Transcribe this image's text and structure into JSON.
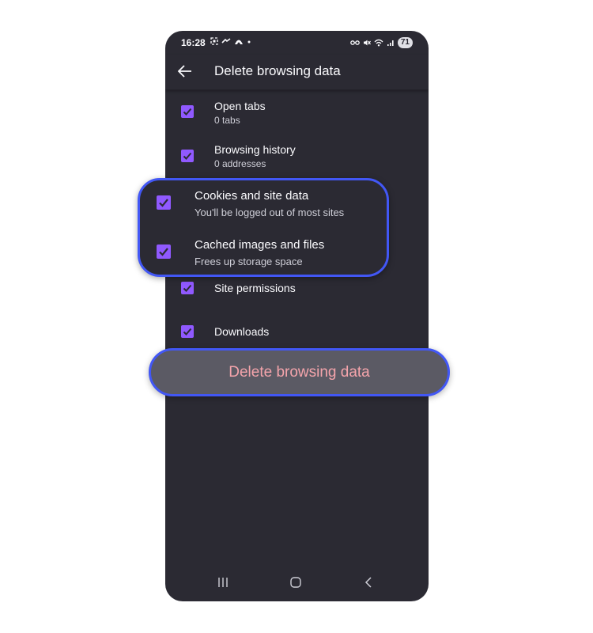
{
  "status_bar": {
    "time": "16:28",
    "battery": "71"
  },
  "toolbar": {
    "title": "Delete browsing data"
  },
  "options": [
    {
      "title": "Open tabs",
      "subtitle": "0 tabs",
      "checked": true
    },
    {
      "title": "Browsing history",
      "subtitle": "0 addresses",
      "checked": true
    },
    {
      "title": "Cookies and site data",
      "subtitle": "You'll be logged out of most sites",
      "checked": true
    },
    {
      "title": "Cached images and files",
      "subtitle": "Frees up storage space",
      "checked": true
    },
    {
      "title": "Site permissions",
      "subtitle": "",
      "checked": true
    },
    {
      "title": "Downloads",
      "subtitle": "",
      "checked": true
    }
  ],
  "delete_button": {
    "label": "Delete browsing data"
  },
  "icons": {
    "back": "back-arrow-icon",
    "checkbox": "checkmark-icon",
    "nav_recents": "recents-icon",
    "nav_home": "home-icon",
    "nav_back": "nav-back-icon"
  },
  "colors": {
    "background": "#2b2a33",
    "checkbox": "#9059ff",
    "highlight": "#4257f5",
    "delete_text": "#f4a4ab",
    "delete_bg": "#5b5a64"
  }
}
